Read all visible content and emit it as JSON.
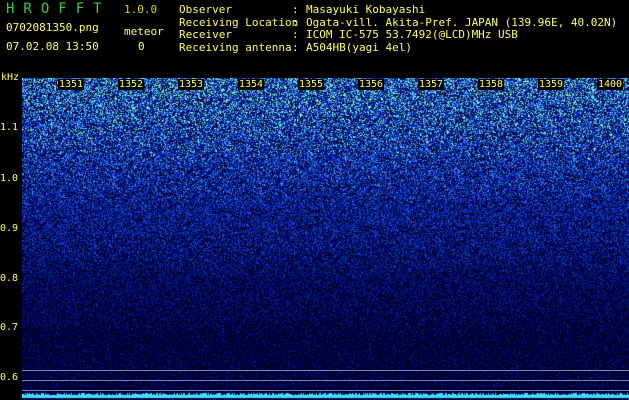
{
  "header": {
    "app_title": "HROFFT",
    "version": "1.0.0",
    "filename": "0702081350.png",
    "datetime": "07.02.08 13:50",
    "meteor_label": "meteor",
    "meteor_count": "0"
  },
  "info": [
    {
      "key": "Observer",
      "value": "Masayuki Kobayashi"
    },
    {
      "key": "Receiving Location",
      "value": "Ogata-vill. Akita-Pref. JAPAN (139.96E, 40.02N)"
    },
    {
      "key": "Receiver",
      "value": "ICOM IC-575 53.7492(@LCD)MHz USB"
    },
    {
      "key": "Receiving antenna",
      "value": "A504HB(yagi 4el)"
    }
  ],
  "plot": {
    "y_unit": "kHz",
    "y_ticks": [
      "1.1",
      "1.0",
      "0.9",
      "0.8",
      "0.7",
      "0.6"
    ],
    "x_ticks": [
      "1351",
      "1352",
      "1353",
      "1354",
      "1355",
      "1356",
      "1357",
      "1358",
      "1359",
      "1400"
    ]
  },
  "colors": {
    "background": "#000000",
    "text": "#ffff60",
    "title": "#38d038",
    "noise_low": "#000030",
    "noise_mid": "#0030c0",
    "noise_high": "#40a0ff",
    "noise_peak": "#80ffd0",
    "baseline": "#40e0ff",
    "marker_lines": "#8080a8"
  }
}
